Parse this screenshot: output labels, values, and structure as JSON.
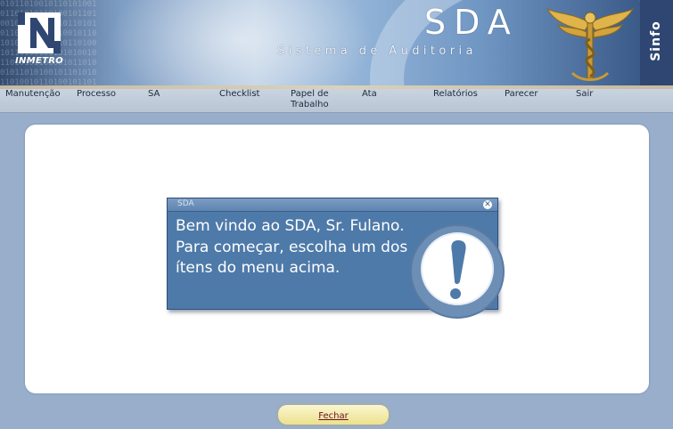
{
  "header": {
    "logo_text": "INMETRO",
    "title": "SDA",
    "subtitle": "Sistema de Auditoria",
    "badge": "Sinfo",
    "background_digits": "0101101001011010100101101010110100101101001011010100101101010110100101101001011010100101101010110100101101001011010100101101010110100101101001011010100101101010110100101101001011010100101101010110",
    "colors": {
      "banner_dark": "#2e4671",
      "banner_light": "#b9cde3",
      "emblem_gold": "#e0b44a"
    }
  },
  "menu": {
    "items": [
      {
        "label": "Manutenção"
      },
      {
        "label": "Processo"
      },
      {
        "label": "SA"
      },
      {
        "label": "Checklist"
      },
      {
        "label": "Papel de Trabalho"
      },
      {
        "label": "Ata"
      },
      {
        "label": "Relatórios"
      },
      {
        "label": "Parecer"
      },
      {
        "label": "Sair"
      }
    ]
  },
  "dialog": {
    "title": "SDA",
    "close_icon": "close-icon",
    "message": "Bem vindo ao SDA, Sr. Fulano. Para começar, escolha um dos ítens do menu acima.",
    "icon": "exclamation-icon",
    "colors": {
      "panel": "#4e7aa9",
      "icon_ring": "#6d8fb6"
    }
  },
  "footer": {
    "close_label": "Fechar",
    "colors": {
      "button": "#f5ecae",
      "link": "#6a0f2a"
    }
  }
}
